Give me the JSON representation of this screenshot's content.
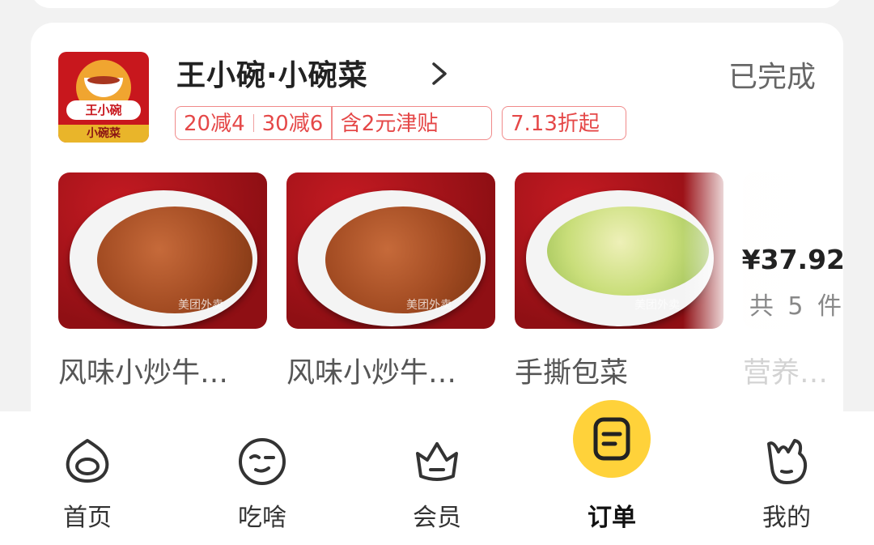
{
  "order": {
    "store_name": "王小碗·小碗菜",
    "status": "已完成",
    "logo": {
      "brand_text": "王小碗",
      "sub_text": "小碗菜"
    },
    "promotions": [
      {
        "segments": [
          "20减4",
          "30减6"
        ],
        "extra": "含2元津贴"
      },
      {
        "segments": [
          "7.13折起"
        ]
      }
    ],
    "items": [
      {
        "name": "风味小炒牛…",
        "image": "beef-dish",
        "watermark": "美团外卖"
      },
      {
        "name": "风味小炒牛…",
        "image": "beef-dish",
        "watermark": "美团外卖"
      },
      {
        "name": "手撕包菜",
        "image": "cabbage-dish",
        "watermark": "美团外卖"
      },
      {
        "name": "营养…",
        "image": "faded-dish"
      }
    ],
    "total_price": "¥37.92",
    "item_count": "共 5 件"
  },
  "tabbar": {
    "tabs": [
      {
        "label": "首页",
        "icon": "home-mascot-icon",
        "active": false
      },
      {
        "label": "吃啥",
        "icon": "face-icon",
        "active": false
      },
      {
        "label": "会员",
        "icon": "crown-icon",
        "active": false
      },
      {
        "label": "订单",
        "icon": "order-icon",
        "active": true
      },
      {
        "label": "我的",
        "icon": "bunny-icon",
        "active": false
      }
    ]
  },
  "colors": {
    "promo_red": "#e54848",
    "active_yellow": "#ffd23a",
    "logo_red": "#c8171d"
  }
}
